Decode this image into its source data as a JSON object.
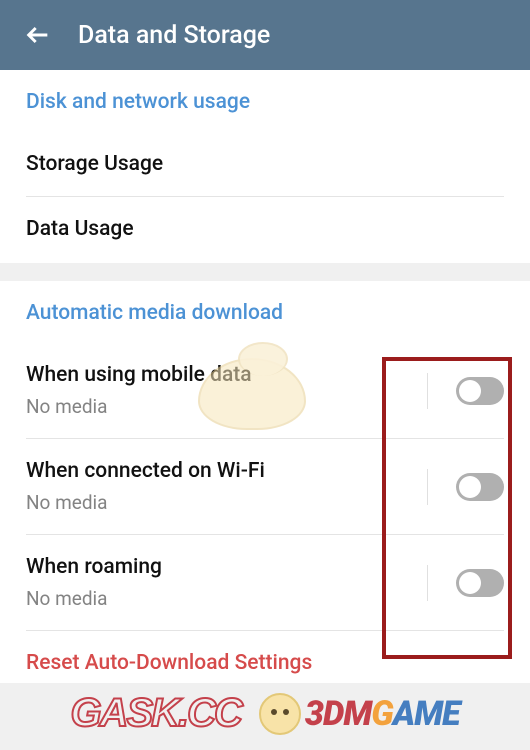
{
  "appbar": {
    "title": "Data and Storage"
  },
  "disk_section": {
    "header": "Disk and network usage",
    "items": {
      "storage": "Storage Usage",
      "data": "Data Usage"
    }
  },
  "auto_section": {
    "header": "Automatic media download",
    "mobile": {
      "title": "When using mobile data",
      "sub": "No media",
      "on": false
    },
    "wifi": {
      "title": "When connected on Wi-Fi",
      "sub": "No media",
      "on": false
    },
    "roaming": {
      "title": "When roaming",
      "sub": "No media",
      "on": false
    },
    "reset": "Reset Auto-Download Settings"
  },
  "watermarks": {
    "gask": "GASK.CC",
    "dm_1": "3DM",
    "dm_2": "G",
    "dm_3": "AME"
  }
}
